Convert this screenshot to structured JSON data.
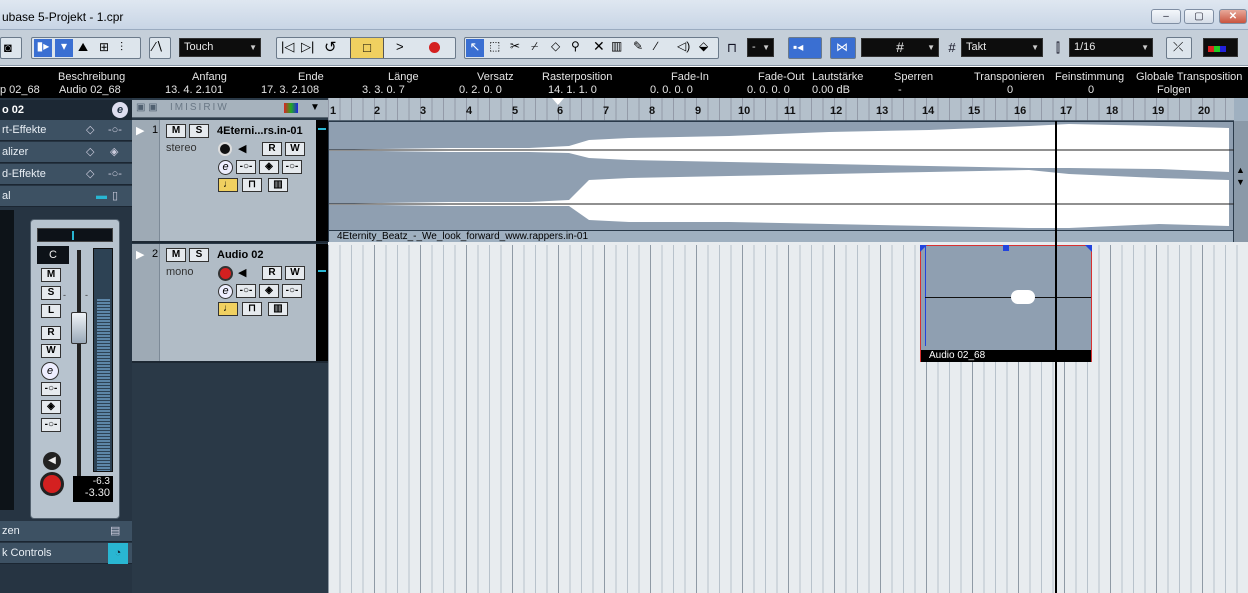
{
  "window": {
    "title": "ubase 5-Projekt - 1.cpr",
    "controls": [
      "–",
      "▢",
      "✕"
    ]
  },
  "toolbar": {
    "automation_mode": "Touch",
    "snap_type": "Takt",
    "quantize": "1/16",
    "grid_glyph": "#",
    "nudge_value": "-"
  },
  "infoline": {
    "headers": [
      "Beschreibung",
      "Anfang",
      "Ende",
      "Länge",
      "Versatz",
      "Rasterposition",
      "Fade-In",
      "Fade-Out",
      "Lautstärke",
      "Sperren",
      "Transponieren",
      "Feinstimmung",
      "Globale Transposition"
    ],
    "values": [
      "Audio 02_68",
      "13. 4. 2.101",
      "17. 3. 2.108",
      "3. 3. 0. 7",
      "0. 2. 0. 0",
      "14. 1. 1. 0",
      "0. 0. 0. 0",
      "0. 0. 0. 0",
      "0.00 dB",
      "-",
      "0",
      "0",
      "Folgen"
    ],
    "left_clip": "p 02_68"
  },
  "inspector": {
    "track_name": "o 02",
    "sections": [
      "rt-Effekte",
      "alizer",
      "d-Effekte",
      "al"
    ],
    "bottom_sections": [
      "zen",
      "k Controls"
    ],
    "pan_value": "C",
    "meter_peak": "-6.3",
    "fader_value": "-3.30",
    "fader_scale": [
      "-",
      "-",
      "-",
      "-"
    ]
  },
  "tracks": [
    {
      "number": "1",
      "name": "4Eterni...rs.in-01",
      "type": "stereo",
      "mute": "M",
      "solo": "S",
      "read": "R",
      "write": "W",
      "edit": "e"
    },
    {
      "number": "2",
      "name": "Audio 02",
      "type": "mono",
      "mute": "M",
      "solo": "S",
      "read": "R",
      "write": "W",
      "edit": "e"
    }
  ],
  "ruler": {
    "bars": [
      "1",
      "2",
      "3",
      "4",
      "5",
      "6",
      "7",
      "8",
      "9",
      "10",
      "11",
      "12",
      "13",
      "14",
      "15",
      "16",
      "17",
      "18",
      "19",
      "20"
    ]
  },
  "events": {
    "event1_label": "4Eternity_Beatz_-_We_look_forward_www.rappers.in-01",
    "event2_label": "Audio 02_68"
  },
  "colors": {
    "selected_button": "#f0d060",
    "record": "#d42020",
    "playhead": "#000000",
    "event_bg": "#8f9fb1",
    "selected_event_border": "#d83030"
  }
}
